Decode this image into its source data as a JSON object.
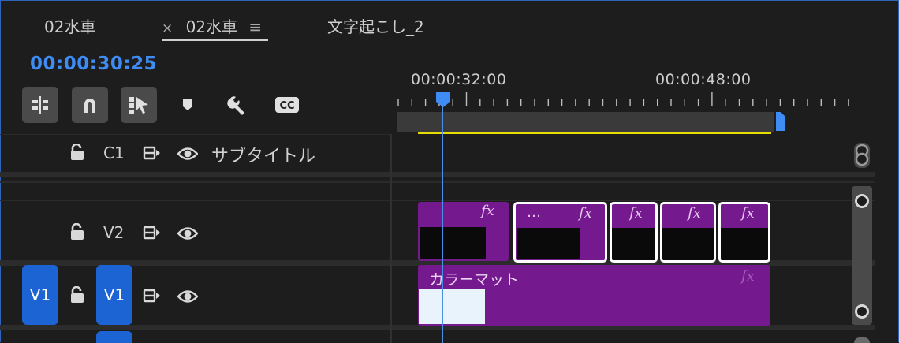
{
  "tabs": [
    {
      "label": "02水車"
    },
    {
      "label": "02水車",
      "close": "×",
      "menu": "≡"
    },
    {
      "label": "文字起こし_2"
    }
  ],
  "timecode": "00:00:30:25",
  "ruler": {
    "labels": [
      "00:00:32:00",
      "00:00:48:00"
    ]
  },
  "tracks": {
    "c1": {
      "id": "C1",
      "name": "サブタイトル"
    },
    "v2": {
      "id": "V2"
    },
    "v1": {
      "id": "V1",
      "source_tag": "V1",
      "target_tag": "V1"
    }
  },
  "clips": {
    "fx_label": "fx",
    "ellipsis": "…",
    "color_matte": "カラーマット"
  },
  "colors": {
    "accent_blue": "#3f8cf5",
    "clip_purple": "#75198f",
    "work_area_yellow": "#e7dc00",
    "track_tag_blue": "#1c64d4"
  },
  "icons": [
    "insert-edit-icon",
    "snap-magnet-icon",
    "linked-selection-icon",
    "add-marker-icon",
    "wrench-settings-icon",
    "closed-captions-icon",
    "lock-icon",
    "sync-track-icon",
    "eye-icon"
  ]
}
